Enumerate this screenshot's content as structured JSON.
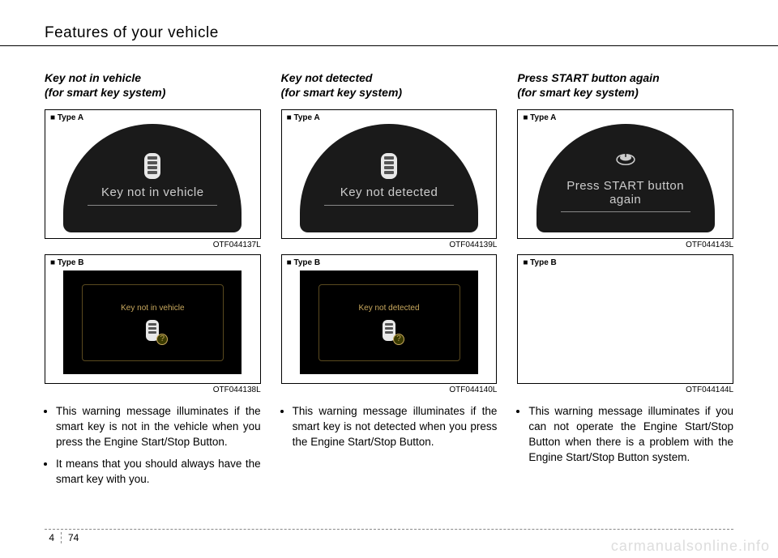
{
  "header": {
    "title": "Features of your vehicle"
  },
  "columns": [
    {
      "title": "Key not in vehicle\n(for smart key system)",
      "typeA": {
        "label": "■ Type A",
        "display_text": "Key not in vehicle",
        "code": "OTF044137L",
        "icon": "fob"
      },
      "typeB": {
        "label": "■ Type B",
        "display_text": "Key not in vehicle",
        "code": "OTF044138L",
        "blank": false,
        "icon": "fob-q"
      },
      "bullets": [
        "This warning message illuminates if the smart key is not in the vehicle when you press the Engine Start/Stop Button.",
        "It means that you should always have the smart key with you."
      ]
    },
    {
      "title": "Key not detected\n(for smart key system)",
      "typeA": {
        "label": "■ Type A",
        "display_text": "Key not detected",
        "code": "OTF044139L",
        "icon": "fob"
      },
      "typeB": {
        "label": "■ Type B",
        "display_text": "Key not detected",
        "code": "OTF044140L",
        "blank": false,
        "icon": "fob-q"
      },
      "bullets": [
        "This warning message illuminates if the smart key is not detected when you press the Engine Start/Stop Button."
      ]
    },
    {
      "title": "Press START button again\n(for smart key system)",
      "typeA": {
        "label": "■ Type A",
        "display_text": "Press START button again",
        "code": "OTF044143L",
        "icon": "start"
      },
      "typeB": {
        "label": "■ Type B",
        "display_text": "",
        "code": "OTF044144L",
        "blank": true,
        "icon": ""
      },
      "bullets": [
        "This warning message illuminates if you can not operate the Engine Start/Stop Button when there is a problem with the Engine Start/Stop Button system."
      ]
    }
  ],
  "footer": {
    "chapter": "4",
    "page": "74"
  },
  "watermark": "carmanualsonline.info"
}
